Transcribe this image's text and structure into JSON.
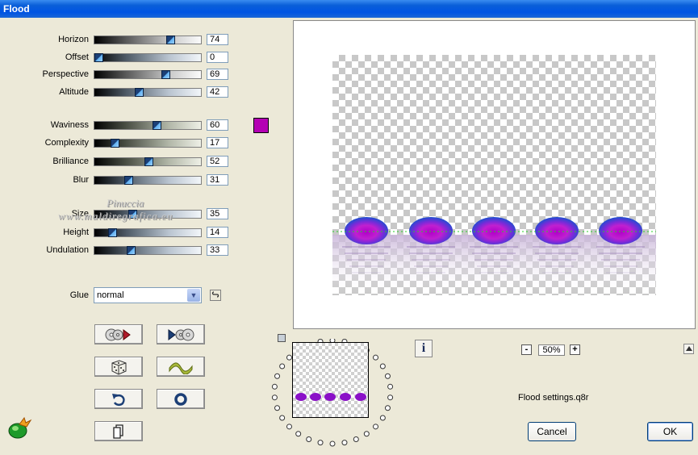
{
  "window": {
    "title": "Flood"
  },
  "sliders": [
    {
      "id": "horizon",
      "label": "Horizon",
      "value": "74",
      "fraction": 0.74,
      "gradient": "g1"
    },
    {
      "id": "offset",
      "label": "Offset",
      "value": "0",
      "fraction": 0.0,
      "gradient": "g2"
    },
    {
      "id": "perspective",
      "label": "Perspective",
      "value": "69",
      "fraction": 0.69,
      "gradient": "g1"
    },
    {
      "id": "altitude",
      "label": "Altitude",
      "value": "42",
      "fraction": 0.42,
      "gradient": "g2"
    },
    {
      "id": "waviness",
      "label": "Waviness",
      "value": "60",
      "fraction": 0.6,
      "gradient": "g3"
    },
    {
      "id": "complexity",
      "label": "Complexity",
      "value": "17",
      "fraction": 0.17,
      "gradient": "g3"
    },
    {
      "id": "brilliance",
      "label": "Brilliance",
      "value": "52",
      "fraction": 0.52,
      "gradient": "g3"
    },
    {
      "id": "blur",
      "label": "Blur",
      "value": "31",
      "fraction": 0.31,
      "gradient": "g2"
    },
    {
      "id": "size",
      "label": "Size",
      "value": "35",
      "fraction": 0.35,
      "gradient": "g2"
    },
    {
      "id": "height",
      "label": "Height",
      "value": "14",
      "fraction": 0.14,
      "gradient": "g2"
    },
    {
      "id": "undulation",
      "label": "Undulation",
      "value": "33",
      "fraction": 0.33,
      "gradient": "g2"
    }
  ],
  "color_swatch": "#b400b4",
  "glue": {
    "label": "Glue",
    "value": "normal"
  },
  "watermark": {
    "line1": "Pinuccia",
    "line2": "www.maldiregrafica.eu"
  },
  "preset_buttons": [
    {
      "id": "save-preset",
      "icon": "disc-arrow-icon"
    },
    {
      "id": "load-preset",
      "icon": "arrow-disc-icon"
    },
    {
      "id": "randomize",
      "icon": "dice-icon"
    },
    {
      "id": "wave",
      "icon": "wave-icon"
    },
    {
      "id": "undo",
      "icon": "undo-icon"
    },
    {
      "id": "reset",
      "icon": "circle-icon"
    },
    {
      "id": "copy",
      "icon": "copy-icon"
    }
  ],
  "zoom": {
    "value": "50%",
    "minus": "-",
    "plus": "+"
  },
  "info_label": "i",
  "settings_file": "Flood settings.q8r",
  "buttons": {
    "cancel": "Cancel",
    "ok": "OK"
  },
  "colors": {
    "titlebar": "#0054e3",
    "dialog": "#ece9d8",
    "blob_outer": "#1c4fd0",
    "blob_inner": "#c400c4"
  }
}
